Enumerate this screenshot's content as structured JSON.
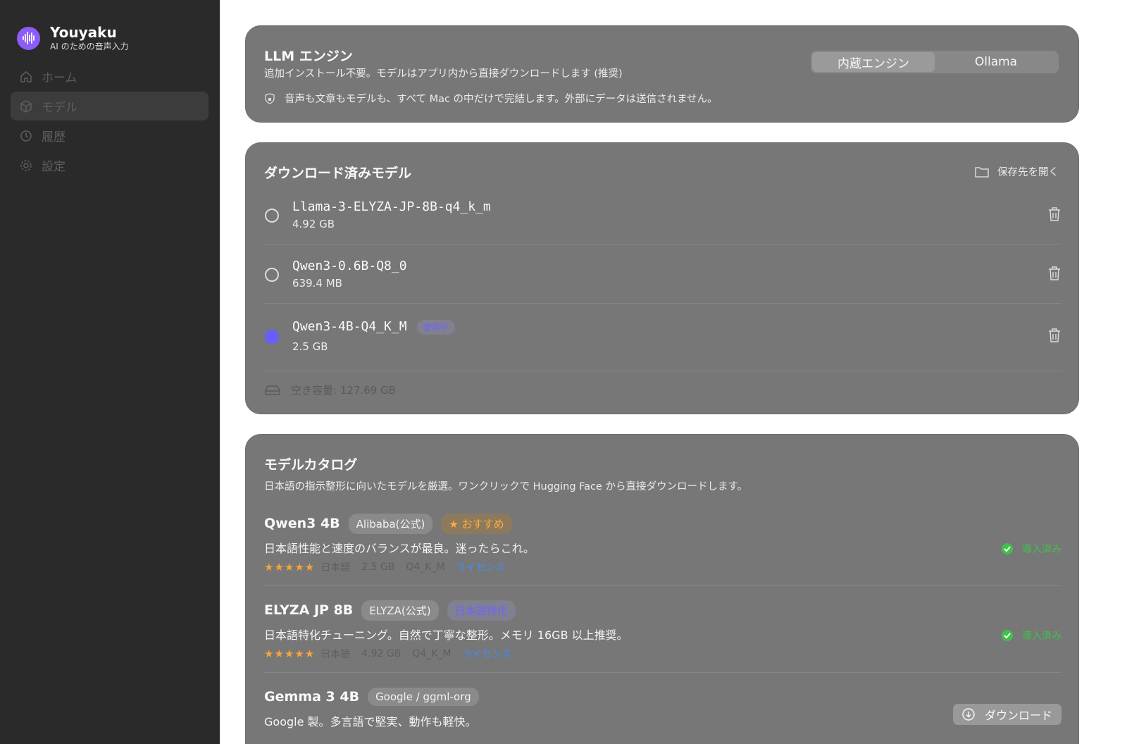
{
  "app": {
    "name": "Youyaku",
    "tagline": "AI のための音声入力",
    "accent": "#8b5cf6"
  },
  "sidebar": {
    "items": [
      {
        "label": "ホーム",
        "icon": "home-icon",
        "active": false
      },
      {
        "label": "モデル",
        "icon": "cube-icon",
        "active": true
      },
      {
        "label": "履歴",
        "icon": "history-icon",
        "active": false
      },
      {
        "label": "設定",
        "icon": "gear-icon",
        "active": false
      }
    ]
  },
  "engine": {
    "title": "LLM エンジン",
    "description": "追加インストール不要。モデルはアプリ内から直接ダウンロードします (推奨)",
    "privacy_note": "音声も文章もモデルも、すべて Mac の中だけで完結します。外部にデータは送信されません。",
    "options": [
      "内蔵エンジン",
      "Ollama"
    ],
    "selected": "内蔵エンジン"
  },
  "downloaded": {
    "title": "ダウンロード済みモデル",
    "open_folder_label": "保存先を開く",
    "models": [
      {
        "name": "Llama-3-ELYZA-JP-8B-q4_k_m",
        "size": "4.92 GB",
        "selected": false
      },
      {
        "name": "Qwen3-0.6B-Q8_0",
        "size": "639.4 MB",
        "selected": false
      },
      {
        "name": "Qwen3-4B-Q4_K_M",
        "size": "2.5 GB",
        "selected": true,
        "badge": "使用中"
      }
    ],
    "free_space": "空き容量: 127.69 GB"
  },
  "catalog": {
    "title": "モデルカタログ",
    "description": "日本語の指示整形に向いたモデルを厳選。ワンクリックで Hugging Face から直接ダウンロードします。",
    "items": [
      {
        "name": "Qwen3 4B",
        "vendor": "Alibaba(公式)",
        "tag": "おすすめ",
        "description": "日本語性能と速度のバランスが最良。迷ったらこれ。",
        "rating_stars": 5,
        "rating_max": 5,
        "language": "日本語",
        "size": "2.5 GB",
        "quant": "Q4_K_M",
        "license_label": "ライセンス",
        "status": "導入済み"
      },
      {
        "name": "ELYZA JP 8B",
        "vendor": "ELYZA(公式)",
        "tag": "日本語特化",
        "description": "日本語特化チューニング。自然で丁寧な整形。メモリ 16GB 以上推奨。",
        "rating_stars": 5,
        "rating_max": 5,
        "language": "日本語",
        "size": "4.92 GB",
        "quant": "Q4_K_M",
        "license_label": "ライセンス",
        "status": "導入済み"
      },
      {
        "name": "Gemma 3 4B",
        "vendor": "Google / ggml-org",
        "description": "Google 製。多言語で堅実、動作も軽快。",
        "action": "ダウンロード"
      }
    ]
  }
}
